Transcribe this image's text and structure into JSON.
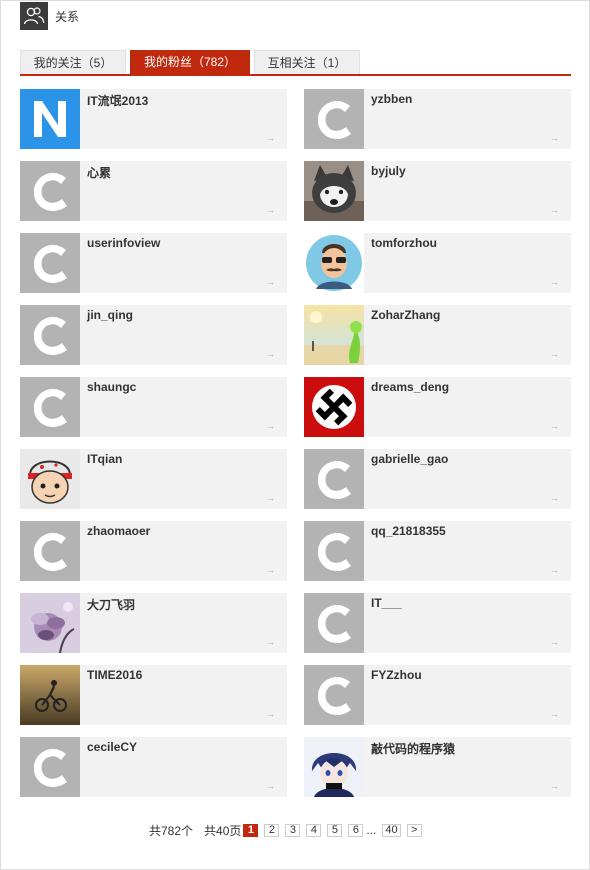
{
  "header": {
    "title": "关系",
    "icon": "users-icon"
  },
  "tabs": [
    {
      "label": "我的关注（5）",
      "active": false
    },
    {
      "label": "我的粉丝（782）",
      "active": true
    },
    {
      "label": "互相关注（1）",
      "active": false
    }
  ],
  "fans": [
    {
      "name": "IT流氓2013",
      "avatar": "letter-n-icon"
    },
    {
      "name": "yzbben",
      "avatar": "default-c-icon"
    },
    {
      "name": "心累",
      "avatar": "default-c-icon"
    },
    {
      "name": "byjuly",
      "avatar": "husky-photo"
    },
    {
      "name": "userinfoview",
      "avatar": "default-c-icon"
    },
    {
      "name": "tomforzhou",
      "avatar": "mustache-man-photo"
    },
    {
      "name": "jin_qing",
      "avatar": "default-c-icon"
    },
    {
      "name": "ZoharZhang",
      "avatar": "beach-photo"
    },
    {
      "name": "shaungc",
      "avatar": "default-c-icon"
    },
    {
      "name": "dreams_deng",
      "avatar": "swastika-symbol"
    },
    {
      "name": "ITqian",
      "avatar": "cartoon-boy-photo"
    },
    {
      "name": "gabrielle_gao",
      "avatar": "default-c-icon"
    },
    {
      "name": "zhaomaoer",
      "avatar": "default-c-icon"
    },
    {
      "name": "qq_21818355",
      "avatar": "default-c-icon"
    },
    {
      "name": "大刀飞羽",
      "avatar": "flower-photo"
    },
    {
      "name": "IT___",
      "avatar": "default-c-icon"
    },
    {
      "name": "TIME2016",
      "avatar": "bicycle-photo"
    },
    {
      "name": "FYZzhou",
      "avatar": "default-c-icon"
    },
    {
      "name": "cecileCY",
      "avatar": "default-c-icon"
    },
    {
      "name": "敲代码的程序猿",
      "avatar": "anime-boy-photo"
    }
  ],
  "card_arrow": "→",
  "pagination": {
    "total_items": "共782个",
    "total_pages": "共40页",
    "pages": [
      "1",
      "2",
      "3",
      "4",
      "5",
      "6"
    ],
    "current": "1",
    "ellipsis": "...",
    "last": "40",
    "next": ">"
  },
  "colors": {
    "accent": "#c0290e",
    "card_bg": "#f2f2f2",
    "default_avatar_bg": "#b3b3b3"
  }
}
